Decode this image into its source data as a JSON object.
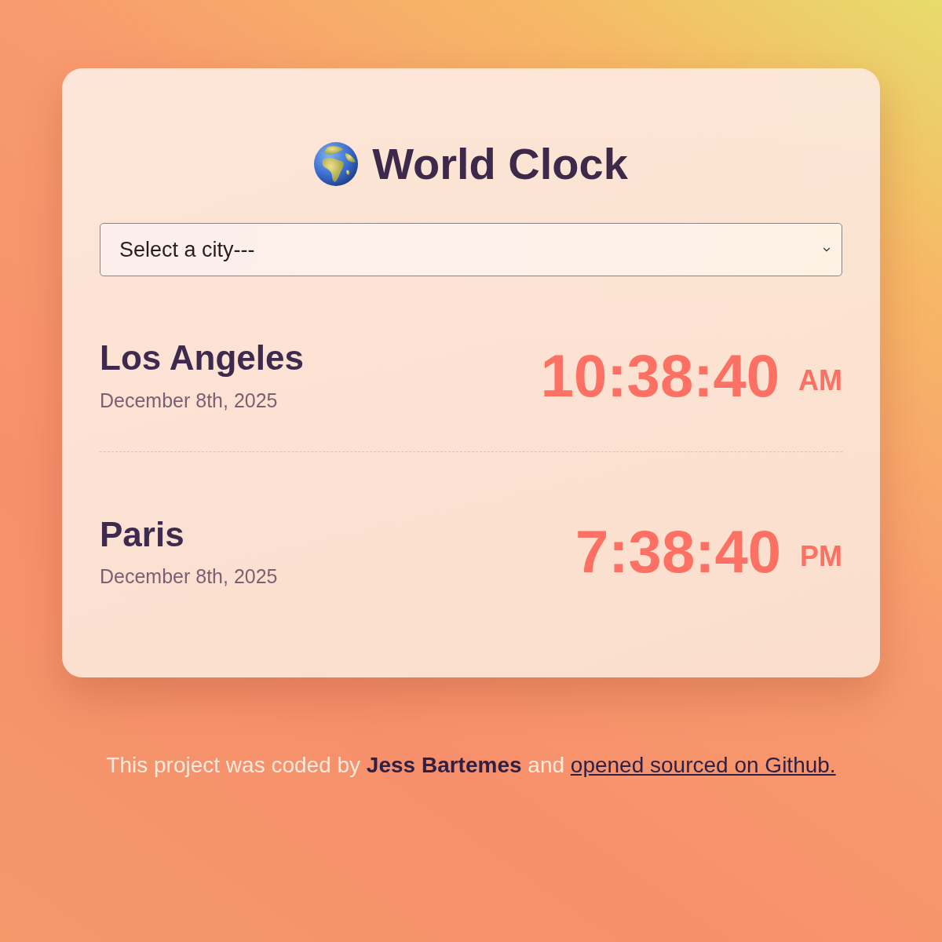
{
  "header": {
    "title": "World Clock"
  },
  "city_select": {
    "label": "Select a city---"
  },
  "cities": [
    {
      "name": "Los Angeles",
      "date": "December 8th, 2025",
      "time": "10:38:40",
      "period": "AM"
    },
    {
      "name": "Paris",
      "date": "December 8th, 2025",
      "time": "7:38:40",
      "period": "PM"
    }
  ],
  "footer": {
    "text": "This project was coded by **Jess Bartemes** and",
    "link": "opened sourced on Github."
  }
}
